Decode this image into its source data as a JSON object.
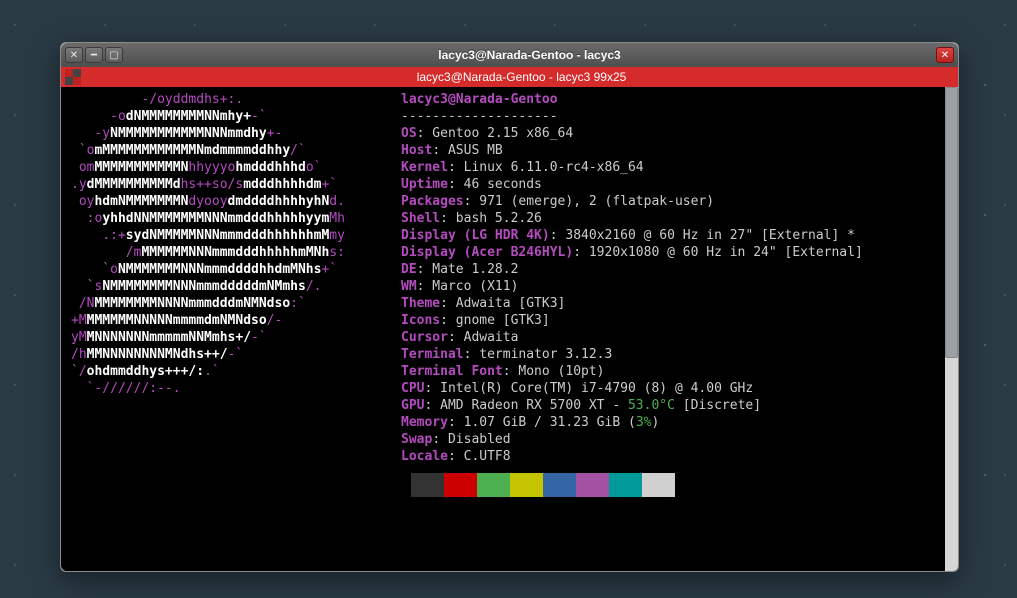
{
  "window": {
    "title": "lacyc3@Narada-Gentoo - lacyc3",
    "tab_title": "lacyc3@Narada-Gentoo - lacyc3 99x25"
  },
  "header": {
    "user_host": "lacyc3@Narada-Gentoo",
    "divider": "--------------------"
  },
  "info": [
    {
      "label": "OS",
      "value": "Gentoo 2.15 x86_64"
    },
    {
      "label": "Host",
      "value": "ASUS MB"
    },
    {
      "label": "Kernel",
      "value": "Linux 6.11.0-rc4-x86_64"
    },
    {
      "label": "Uptime",
      "value": "46 seconds"
    },
    {
      "label": "Packages",
      "value": "971 (emerge), 2 (flatpak-user)"
    },
    {
      "label": "Shell",
      "value": "bash 5.2.26"
    },
    {
      "label": "Display (LG HDR 4K)",
      "value": "3840x2160 @ 60 Hz in 27\" [External] *"
    },
    {
      "label": "Display (Acer B246HYL)",
      "value": "1920x1080 @ 60 Hz in 24\" [External]"
    },
    {
      "label": "DE",
      "value": "Mate 1.28.2"
    },
    {
      "label": "WM",
      "value": "Marco (X11)"
    },
    {
      "label": "Theme",
      "value": "Adwaita [GTK3]"
    },
    {
      "label": "Icons",
      "value": "gnome [GTK3]"
    },
    {
      "label": "Cursor",
      "value": "Adwaita"
    },
    {
      "label": "Terminal",
      "value": "terminator 3.12.3"
    },
    {
      "label": "Terminal Font",
      "value": "Mono (10pt)"
    },
    {
      "label": "CPU",
      "value": "Intel(R) Core(TM) i7-4790 (8) @ 4.00 GHz"
    },
    {
      "label": "GPU",
      "value": "AMD Radeon RX 5700 XT - ",
      "special": "53.0°C",
      "tail": " [Discrete]"
    },
    {
      "label": "Memory",
      "value": "1.07 GiB / 31.23 GiB (",
      "special": "3%",
      "tail": ")"
    },
    {
      "label": "Swap",
      "value": "Disabled"
    },
    {
      "label": "Locale",
      "value": "C.UTF8"
    }
  ],
  "logo_lines": [
    {
      "pre": "         ",
      "mag": "-/oyddmdhs+:.",
      "wht": "",
      "post": ""
    },
    {
      "pre": "     ",
      "mag": "-o",
      "wht": "dNMMMMMMMMNNmhy+",
      "post": "-`"
    },
    {
      "pre": "   ",
      "mag": "-y",
      "wht": "NMMMMMMMMMMMNNNmmdhy",
      "post": "+-"
    },
    {
      "pre": " `",
      "mag": "o",
      "wht": "mMMMMMMMMMMMMNmdmmmmddhhy",
      "post": "/`"
    },
    {
      "pre": " ",
      "mag": "om",
      "wht": "MMMMMMMMMMMN",
      "mag2": "hhyyyo",
      "wht2": "hmdddhhhd",
      "post": "o`"
    },
    {
      "pre": "",
      "mag": ".y",
      "wht": "dMMMMMMMMMMd",
      "mag2": "hs++so/s",
      "wht2": "mdddhhhhdm",
      "post": "+`"
    },
    {
      "pre": " ",
      "mag": "oy",
      "wht": "hdmNMMMMMMMN",
      "mag2": "dyooy",
      "wht2": "dmddddhhhhyhN",
      "post": "d."
    },
    {
      "pre": "  ",
      "mag": ":o",
      "wht": "yhhdNNMMMMMMMNNNmmdddhhhhhyym",
      "post": "Mh"
    },
    {
      "pre": "    ",
      "mag": ".:+",
      "wht": "sydNMMMMMNNNmmmdddhhhhhhmM",
      "post": "my"
    },
    {
      "pre": "       ",
      "mag": "/m",
      "wht": "MMMMMMNNNmmmdddhhhhhmMNh",
      "post": "s:"
    },
    {
      "pre": "    `",
      "mag": "o",
      "wht": "NMMMMMMMNNNmmmddddhhdmMNhs",
      "post": "+`"
    },
    {
      "pre": "  `",
      "mag": "s",
      "wht": "NMMMMMMMMNNNmmmdddddmNMmhs",
      "post": "/."
    },
    {
      "pre": " ",
      "mag": "/N",
      "wht": "MMMMMMMMNNNNmmmdddmNMNdso",
      "post": ":`"
    },
    {
      "pre": "",
      "mag": "+M",
      "wht": "MMMMMMNNNNNmmmmdmNMNdso",
      "post": "/-"
    },
    {
      "pre": "",
      "mag": "yM",
      "wht": "MNNNNNNNmmmmmNNMmhs+/",
      "post": "-`"
    },
    {
      "pre": "",
      "mag": "/h",
      "wht": "MMNNNNNNNNMNdhs++/",
      "post": "-`"
    },
    {
      "pre": "`",
      "mag": "/",
      "wht": "ohdmmddhys+++/:",
      "post": ".`"
    },
    {
      "pre": "  ",
      "mag": "`-//////:--.",
      "wht": "",
      "post": ""
    }
  ],
  "color_swatches": [
    "#333333",
    "#cc0000",
    "#4caf50",
    "#c4c400",
    "#3465a4",
    "#a352a3",
    "#009a9a",
    "#d0d0d0"
  ]
}
